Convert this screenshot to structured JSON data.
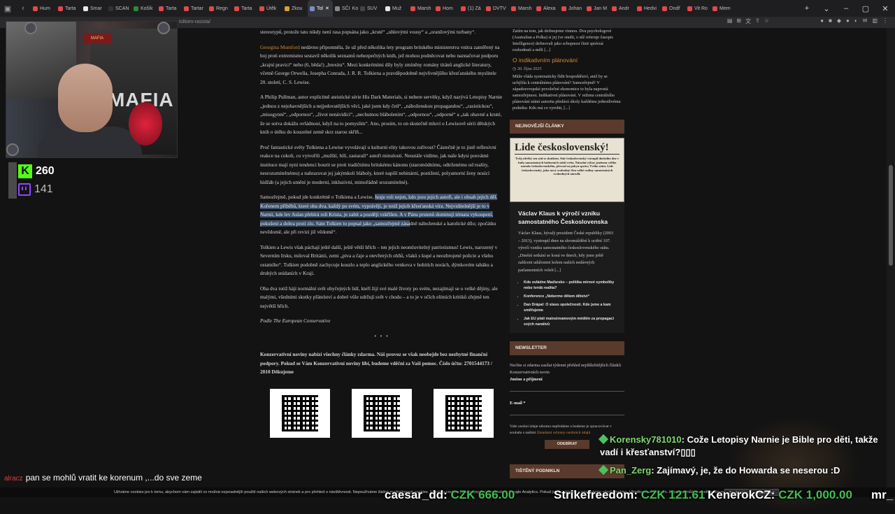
{
  "browser": {
    "tabs": [
      {
        "label": "Hum",
        "color": "#e04a4a"
      },
      {
        "label": "Tarta",
        "color": "#e04a4a"
      },
      {
        "label": "Smar",
        "color": "#e8e8e8"
      },
      {
        "label": "SCAN",
        "color": "#333333"
      },
      {
        "label": "Košík",
        "color": "#2c8a3c"
      },
      {
        "label": "Tarta",
        "color": "#e04a4a"
      },
      {
        "label": "Tartar",
        "color": "#e04a4a"
      },
      {
        "label": "Regn",
        "color": "#e04a4a"
      },
      {
        "label": "Tarta",
        "color": "#e04a4a"
      },
      {
        "label": "Útěk",
        "color": "#e04a4a"
      },
      {
        "label": "Zkou",
        "color": "#d5a23a"
      },
      {
        "label": "Tol",
        "color": "#7b8cd0",
        "active": true
      },
      {
        "label": "Komi",
        "color": "#888888",
        "prefix": "SČI"
      },
      {
        "label": "SUV",
        "color": "#444444"
      },
      {
        "label": "Muž",
        "color": "#e8e8e8"
      },
      {
        "label": "Marsh",
        "color": "#e04a4a"
      },
      {
        "label": "Hom",
        "color": "#e04a4a"
      },
      {
        "label": "(1) Zá",
        "color": "#e04a4a"
      },
      {
        "label": "DVTV",
        "color": "#e04a4a"
      },
      {
        "label": "Marsh",
        "color": "#e04a4a"
      },
      {
        "label": "Alexa",
        "color": "#e04a4a"
      },
      {
        "label": "Johan",
        "color": "#e04a4a"
      },
      {
        "label": "Jan M",
        "color": "#e04a4a"
      },
      {
        "label": "Andr",
        "color": "#e04a4a"
      },
      {
        "label": "Hedvi",
        "color": "#e04a4a"
      },
      {
        "label": "Ondř",
        "color": "#e04a4a"
      },
      {
        "label": "Vit Ro",
        "color": "#e04a4a"
      },
      {
        "label": "Mem",
        "color": "#e04a4a"
      }
    ],
    "url": "tolkien-rasista/"
  },
  "article": {
    "p0": "stereotypů, protože tato nikdy není rasa popsána jako „kruté“ „uhlovými vousy“ a „oranžovými turbany“.",
    "p1_author": "Georgina Mumford",
    "p1_rest": " nedávno připomněla, že už před několika lety program britského ministerstva vnitra zaměřený na boj proti extremismu  sestavil několik seznamů nebezpečných knih, jež mohou podněcovat nebo naznačovat podporu „krajní pravici“ nebo (6, běda!) „brexitu“. Mezi konkrétními díly byly zmíněny romány titánů anglické literatury, včetně George Orwella, Josepha Conrada, J. R. R. Tolkiena a pravděpodobně nejvlivnějšího křesťanského myslitele 20. století, C. S. Lewise.",
    "p2": "A Philip Pullman, autor explicitně ateistické série His Dark Materials, si nebere servítky, když nazývá Letopisy Narnie „jednou z nejohavnějších a nejjedovatějších věcí, jaké jsem kdy četl“, „náboženskou propagandou“, „rasistickou“, „misogynní“, „odpornou“, „život nenávidící“, „nechutnou blábolením“, „odpornou“, „odporné“ a „tak ohavné a kruté, že se sotva dokážu ovládnout, když na to pomyslím“. Ano, prosím, to on skutečně mluví o Lewisově sérii dětských knih o útěku do kouzelné země skrz starou skříň...",
    "p3": "Proč fantastické světy Tolkiena a Lewise vyvolávají u kulturní elity takovou zuřivost? Částečně je to jistě reflexivní reakce na cokoli, co vytvořili „mužští, bílí, zastaralí“ autoři minulosti. Neustále vidíme, jak naše kdysi posvátné instituce mají nyní tendenci bourit se proti tradičnímu britskému kánonu (staromódnímu, odtrženému od reality, nesrozumitelnému) a nahrazovat jej jakýmkoli bláboly, které napíší nebinární, postižení, polyamorní ženy nosící hidžáb (a jejich umění je moderní, inkluzivní, mimořádně srozumitelné).",
    "p4_pre": "Samozřejmě, pokud jde konkrétně o Tolkiena a Lewise, ",
    "p4_hl": "hraje roli nejen, kdo jsou jejich autoři, ale i obsah jejich děl. Kořenem příběhů, které oba dva, každý po svém, vyprávějí, je totiž jejich křesťanská víra. Nejviditelnější je to v Narnii, kde lev Aslan přebírá roli Krista, je zabit a později vzkříšen. A v Pánu prstenů dominují témata vykoupení, pokušení a dobra proti zlu. Sám Tolkien to popsal jako „samozřejmě zása",
    "p4_post": "dně náboženské a katolické dílo; zpočátku nevědomě, ale při revizi již vědomě“.",
    "p5": "Tolkien a Lewis však páchají ještě další, ještě větší hřích – ten jejich neomluvitelný patriotismus! Lewis, narozený v Severním Irsku, miloval Británii, zemi „piva a čaje a otevřených ohňů, vlaků s kupé a neozbrojené policie a všeho ostatního“. Tolkien podobně zachycuje kouzlo a teplo anglického venkova v hobitích norách, dýmkovém tabáku a druhých snídaních v Kraji.",
    "p6": "Oba dva totiž hájí normální svět obyčejných lidí, kteří žijí své malé životy po svém, nezajímají se o velké dějiny, ale malými, všedními skutky přátelství a dobré vůle udržují svět v chodu – a to je v očích elitních kritiků zřejmě ten největší hřích.",
    "source": "Podle The European Conservative",
    "dots": "• • •",
    "support": "Konzervativní noviny nabízí všechny články zdarma. Náš provoz se však neobejde bez nezbytné finanční podpory. Pokud se Vám Konzervativní noviny líbí, budeme vděčni za Vaši pomoc. Číslo účtu: 2701544173 / 2010 Děkujeme"
  },
  "sidebar": {
    "intro": "Zatím na tom, jak definujeme vinnou. Dva psychologové (Australian a Polka) si jej (ve studii, o níž referuje časopis Intelligence) definovali jako schopnost činit správná rozhodnutí a měli [...]",
    "intro_more": "[...]",
    "article_title": "O indikativním plánování",
    "article_date": "20. října 2025",
    "article_body": "Může vláda systematicky řídit hospodářství, aniž by se uchýlila k centrálnímu plánování? Samozřejmě! V západoevropské povolečné ekonomice to byla naprostá samozřejmost. Indikativní plánování. V režimu centrálního plánování státní autorita předává úkoly každému jednotlivému podniku: Kdo má co vyrobit, [...]",
    "newest_heading": "NEJNOVĚJŠÍ ČLÁNKY",
    "img_big": "Lide československý!",
    "img_small": "Tvůj odvěký sen stal se skutkem. Stát československý vstoupil dnešního dne v řadu samostatných kulturních států světa. Národní výbor, jménem celého národa československého, převzal za pokyn správy Tvého státu. Lide československý, jako nový svobodný člen velké rodiny samostatných svobodných národů.",
    "card_title": "Václav Klaus k výročí vzniku samostatného Československa",
    "card_body": "Václav Klaus, bývalý prezident České republiky (2003 – 2013), vystoupil dnes na shromáždění k uctění 107. výročí vzniku samostatného československého státu. „Dnešní setkání se koná ve dnech, kdy jsme ještě zahlceni událostmi kolem našich nedávných parlamentních voleb [...]",
    "list": [
      "Kdo ovládne Maďarsko – politika mírové symboliky nebo tvrdá realita?",
      "Konference „Neberme dětem dětství“",
      "Dan Drápal: O stavu společnosti. Kde jsme a kam směřujeme",
      "Jak EU platí mainstreamovým médiím za propagaci svých narativů"
    ],
    "newsletter_heading": "NEWSLETTER",
    "newsletter_text": "Nechte si zdarma zasílat týdenní přehled nejdůležitějších článků Konzervativních novin",
    "label_name": "Jméno a příjmení",
    "label_email": "E-mail *",
    "gdpr": "Vaše osobní údaje nikomu nepředáme a budeme je zpracovávat v souladu s našimi ",
    "gdpr_link": "Zásadami ochrany osobních údajů",
    "button": "ODEBÍRAT",
    "print_heading": "TIŠTĚNÝ PODNIKLN"
  },
  "stream": {
    "kick_count": "260",
    "twitch_count": "141",
    "banner": "MAFIA",
    "webcam_text": "MAFIA",
    "chat_left_user": "alracz",
    "chat_left_text": "pan se mohlů vratit ke korenum ,...do sve zeme",
    "chat": [
      {
        "user": "Korensky781010",
        "text": ": Cože Letopisy Narnie je Bible pro děti, takže vadí i křesťanství?▯▯▯"
      },
      {
        "user": "Pan_Zerg",
        "text": ": Zajímavý, je, že do Howarda se neserou :D"
      }
    ],
    "ticker": [
      {
        "name": "caesar_dd:",
        "amount": "CZK 666.00"
      },
      {
        "name": "Strikefreedom:",
        "amount": "CZK 121.61"
      },
      {
        "name": "KenerokCZ:",
        "amount": "CZK 1,000.00"
      },
      {
        "name": "mr_",
        "amount": ""
      }
    ]
  },
  "cookie": {
    "text": "Užíváme cookies jen k tomu, abychom vám zajistili co možná nejsnadnější použití našich webových stránek a pro přehled o návštěvnosti. Nepoužíváme žádné marketingové cookies. Všechny cookies jsou anonymní. Používáme Google Analytics. Pokud jste souhlasíte s používáním všech cookies, klikněte na souhlasím. Případně můžete zvolit nastavení cookies souhlas.",
    "accept": "Souhlasím",
    "reject": "Odmítnout"
  }
}
